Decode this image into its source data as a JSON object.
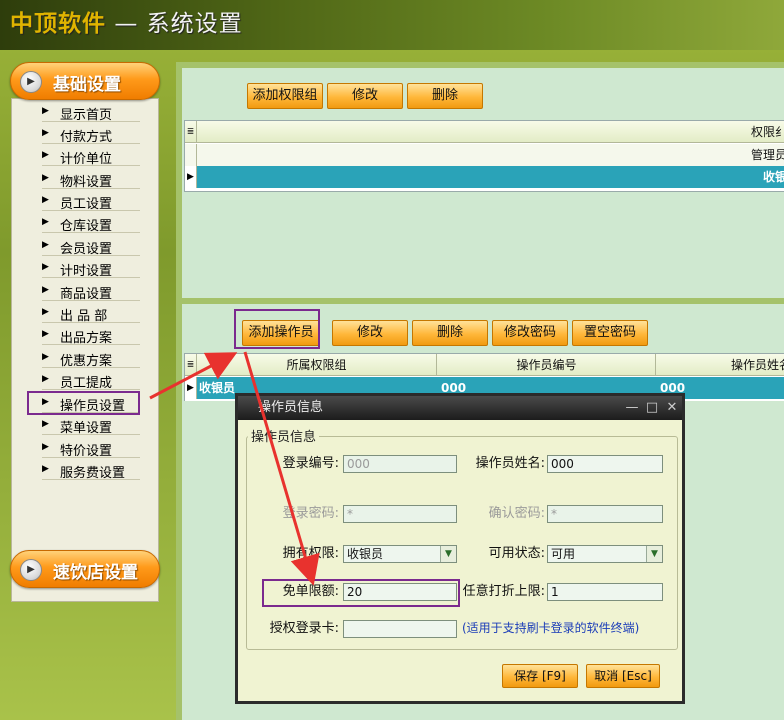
{
  "app": {
    "brand": "中顶软件",
    "sep": "—",
    "title": "系统设置"
  },
  "sidebar": {
    "basic_label": "基础设置",
    "fast_label": "速饮店设置",
    "items": [
      "显示首页",
      "付款方式",
      "计价单位",
      "物料设置",
      "员工设置",
      "仓库设置",
      "会员设置",
      "计时设置",
      "商品设置",
      "出 品 部",
      "出品方案",
      "优惠方案",
      "员工提成",
      "操作员设置",
      "菜单设置",
      "特价设置",
      "服务费设置"
    ]
  },
  "top_toolbar": {
    "add": "添加权限组",
    "edit": "修改",
    "delete": "删除"
  },
  "group_grid": {
    "header": "权限纟",
    "rows": [
      "管理员",
      "收银"
    ]
  },
  "bottom_toolbar": {
    "add": "添加操作员",
    "edit": "修改",
    "delete": "删除",
    "change_pwd": "修改密码",
    "clear_pwd": "置空密码"
  },
  "op_grid": {
    "headers": [
      "所属权限组",
      "操作员编号",
      "操作员姓名"
    ],
    "row": [
      "收银员",
      "000",
      "000"
    ]
  },
  "dialog": {
    "title": "操作员信息",
    "group_title": "操作员信息",
    "login_no_label": "登录编号:",
    "login_no_value": "000",
    "name_label": "操作员姓名:",
    "name_value": "000",
    "pwd_label": "登录密码:",
    "pwd_value": "*",
    "confirm_label": "确认密码:",
    "confirm_value": "*",
    "role_label": "拥有权限:",
    "role_value": "收银员",
    "status_label": "可用状态:",
    "status_value": "可用",
    "free_label": "免单限额:",
    "free_value": "20",
    "discount_label": "任意打折上限:",
    "discount_value": "1",
    "card_label": "授权登录卡:",
    "card_value": "",
    "hint": "(适用于支持刷卡登录的软件终端)",
    "save": "保存 [F9]",
    "cancel": "取消 [Esc]"
  },
  "colors": {
    "accent": "#ff9a1a",
    "selection": "#2aa3b8",
    "highlight": "#7b2a8e",
    "arrow": "#e8322e"
  }
}
